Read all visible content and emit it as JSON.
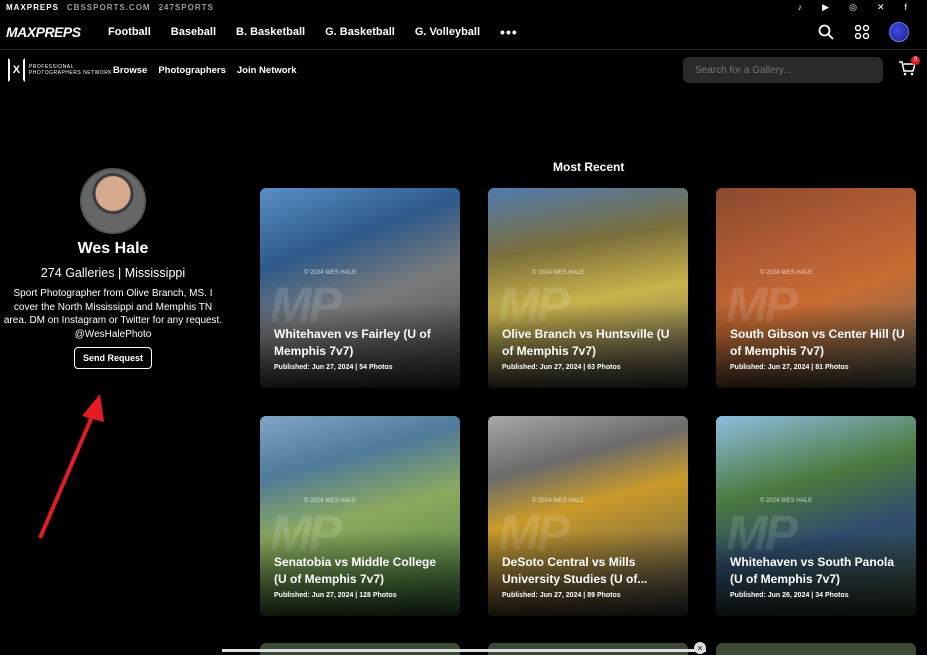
{
  "topbar": {
    "brands": [
      "MAXPREPS",
      "CBSSPORTS.COM",
      "247SPORTS"
    ],
    "social_icons": [
      "tiktok-icon",
      "youtube-icon",
      "instagram-icon",
      "x-icon",
      "facebook-icon"
    ]
  },
  "nav": {
    "logo": "MAXPREPS",
    "items": [
      "Football",
      "Baseball",
      "B. Basketball",
      "G. Basketball",
      "G. Volleyball"
    ],
    "more": "•••"
  },
  "subnav": {
    "ppn_text": "PROFESSIONAL PHOTOGRAPHERS NETWORK",
    "links": [
      "Browse",
      "Photographers",
      "Join Network"
    ],
    "search_placeholder": "Search for a Gallery...",
    "cart_count": "0"
  },
  "profile": {
    "name": "Wes Hale",
    "meta": "274 Galleries | Mississippi",
    "bio": "Sport Photographer from Olive Branch, MS. I cover the North Mississippi and Memphis TN area. DM on Instagram or Twitter for any request.",
    "handle": "@WesHalePhoto",
    "button": "Send Request"
  },
  "section_title": "Most Recent",
  "galleries": [
    {
      "title": "Whitehaven vs Fairley (U of Memphis 7v7)",
      "published": "Published: Jun 27, 2024 | 54 Photos"
    },
    {
      "title": "Olive Branch vs Huntsville (U of Memphis 7v7)",
      "published": "Published: Jun 27, 2024 | 63 Photos"
    },
    {
      "title": "South Gibson vs Center Hill (U of Memphis 7v7)",
      "published": "Published: Jun 27, 2024 | 81 Photos"
    },
    {
      "title": "Senatobia vs Middle College (U of Memphis 7v7)",
      "published": "Published: Jun 27, 2024 | 128 Photos"
    },
    {
      "title": "DeSoto Central vs Mills University Studies (U of...",
      "published": "Published: Jun 27, 2024 | 89 Photos"
    },
    {
      "title": "Whitehaven vs South Panola (U of Memphis 7v7)",
      "published": "Published: Jun 26, 2024 | 34 Photos"
    }
  ],
  "watermark": {
    "text": "MP",
    "credit": "© 2024 WES HALE"
  },
  "ad": {
    "close": "✕"
  }
}
